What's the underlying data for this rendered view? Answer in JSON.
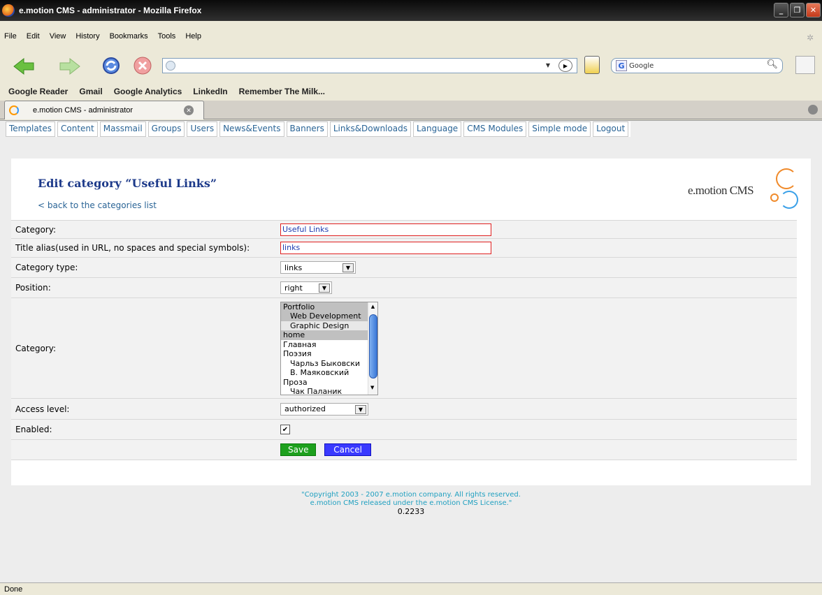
{
  "window": {
    "title": "e.motion CMS - administrator - Mozilla Firefox"
  },
  "menu": [
    "File",
    "Edit",
    "View",
    "History",
    "Bookmarks",
    "Tools",
    "Help"
  ],
  "search": {
    "placeholder": "Google"
  },
  "bookmarks": [
    "Google Reader",
    "Gmail",
    "Google Analytics",
    "LinkedIn",
    "Remember The Milk..."
  ],
  "tab": {
    "label": "e.motion CMS - administrator"
  },
  "cms_menu": [
    "Templates",
    "Content",
    "Massmail",
    "Groups",
    "Users",
    "News&Events",
    "Banners",
    "Links&Downloads",
    "Language",
    "CMS Modules",
    "Simple mode",
    "Logout"
  ],
  "page": {
    "title": "Edit category “Useful Links”",
    "back_link": "< back to the categories list",
    "logo_text": "e.motion CMS"
  },
  "form": {
    "category_label": "Category:",
    "category_value": "Useful Links",
    "alias_label": "Title alias(used in URL, no spaces and special symbols):",
    "alias_value": "links",
    "type_label": "Category type:",
    "type_value": "links",
    "position_label": "Position:",
    "position_value": "right",
    "parent_label": "Category:",
    "parent_options": [
      "Portfolio",
      "Web Development",
      "Graphic Design",
      "home",
      "Главная",
      "Поэзия",
      "Чарльз Быковски",
      "В. Маяковский",
      "Проза",
      "Чак Паланик"
    ],
    "access_label": "Access level:",
    "access_value": "authorized",
    "enabled_label": "Enabled:",
    "enabled_checked": true,
    "save_label": "Save",
    "cancel_label": "Cancel"
  },
  "footer": {
    "line1": "\"Copyright 2003 - 2007 e.motion company. All rights reserved.",
    "line2": "e.motion CMS released under the e.motion CMS License.\"",
    "version": "0.2233"
  },
  "status": {
    "text": "Done"
  }
}
